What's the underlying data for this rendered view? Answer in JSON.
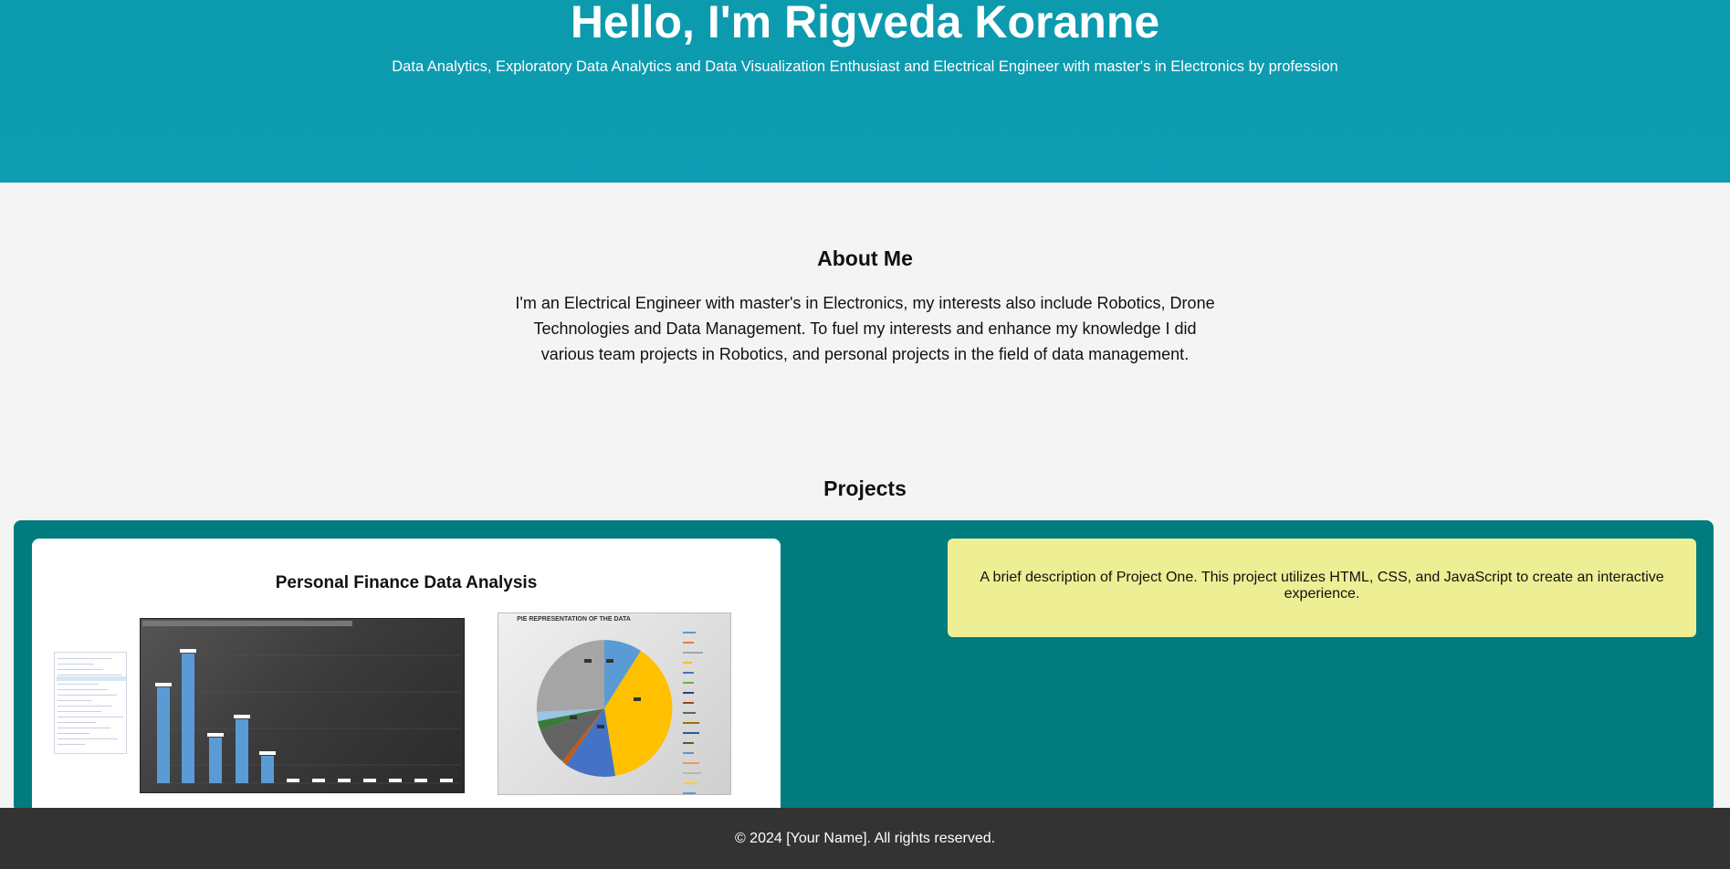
{
  "hero": {
    "title": "Hello, I'm Rigveda Koranne",
    "subtitle": "Data Analytics, Exploratory Data Analytics and Data Visualization Enthusiast and Electrical Engineer with master's in Electronics by profession"
  },
  "about": {
    "title": "About Me",
    "text": "I'm an Electrical Engineer with master's in Electronics, my interests also include Robotics, Drone Technologies and Data Management. To fuel my interests and enhance my knowledge I did various team projects in Robotics, and personal projects in the field of data management."
  },
  "projects": {
    "title": "Projects",
    "cards": [
      {
        "title": "Personal Finance Data Analysis",
        "images": [
          "filter-list-screenshot",
          "bar-chart-screenshot",
          "pie-chart-screenshot"
        ],
        "pie_title": "PIE REPRESENTATION OF THE DATA"
      }
    ],
    "description": "A brief description of Project One. This project utilizes HTML, CSS, and JavaScript to create an interactive experience."
  },
  "footer": {
    "text": "© 2024 [Your Name]. All rights reserved."
  },
  "colors": {
    "hero_bg": "#0e9cb2",
    "panel_bg": "#007b7e",
    "desc_bg": "#eeee95",
    "footer_bg": "#333333",
    "page_bg": "#f4f4f4"
  }
}
